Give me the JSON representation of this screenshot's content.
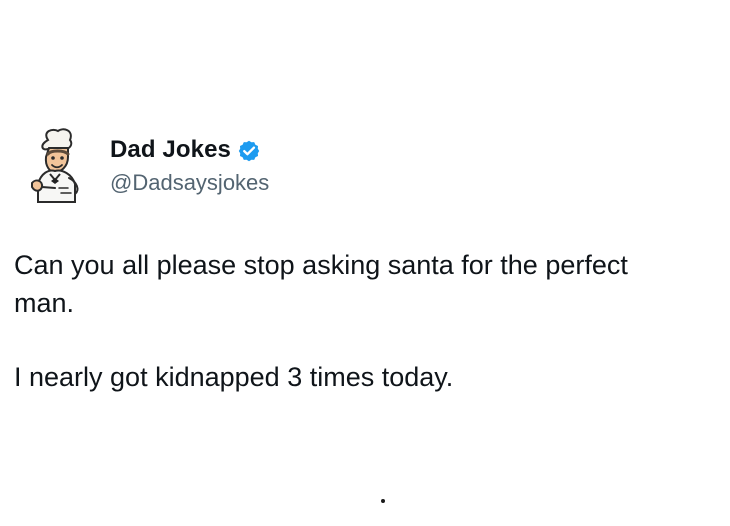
{
  "tweet": {
    "author": {
      "display_name": "Dad Jokes",
      "handle": "@Dadsaysjokes",
      "verified": true,
      "avatar_icon": "chef-cartoon-avatar",
      "verified_icon": "verified-badge-icon"
    },
    "text": {
      "paragraphs": [
        "Can you all please stop asking santa for the perfect\nman.",
        "I nearly got kidnapped 3 times today."
      ]
    }
  },
  "colors": {
    "background": "#ffffff",
    "text": "#0f1419",
    "secondary_text": "#536471",
    "verified_blue": "#1d9bf0"
  }
}
